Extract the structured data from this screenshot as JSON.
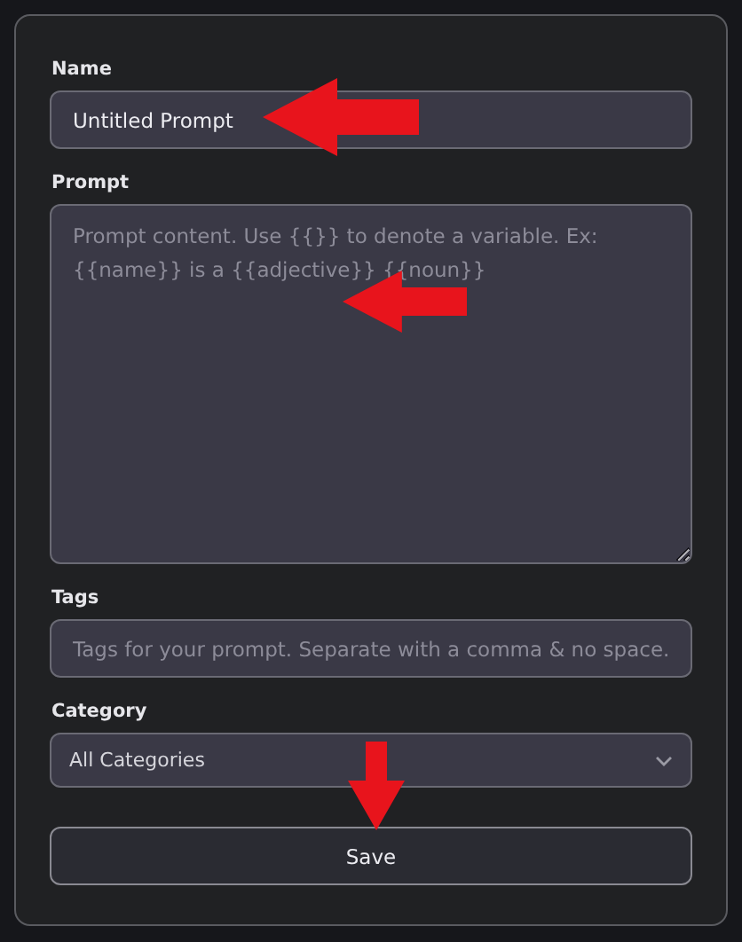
{
  "form": {
    "fields": [
      {
        "kind": "input",
        "label": "Name",
        "value": "Untitled Prompt"
      },
      {
        "kind": "textarea",
        "label": "Prompt",
        "placeholder": "Prompt content. Use {{}} to denote a variable. Ex: {{name}} is a {{adjective}} {{noun}}"
      },
      {
        "kind": "input",
        "label": "Tags",
        "placeholder": "Tags for your prompt. Separate with a comma & no space."
      },
      {
        "kind": "select",
        "label": "Category",
        "value": "All Categories"
      }
    ],
    "save_button": "Save"
  }
}
